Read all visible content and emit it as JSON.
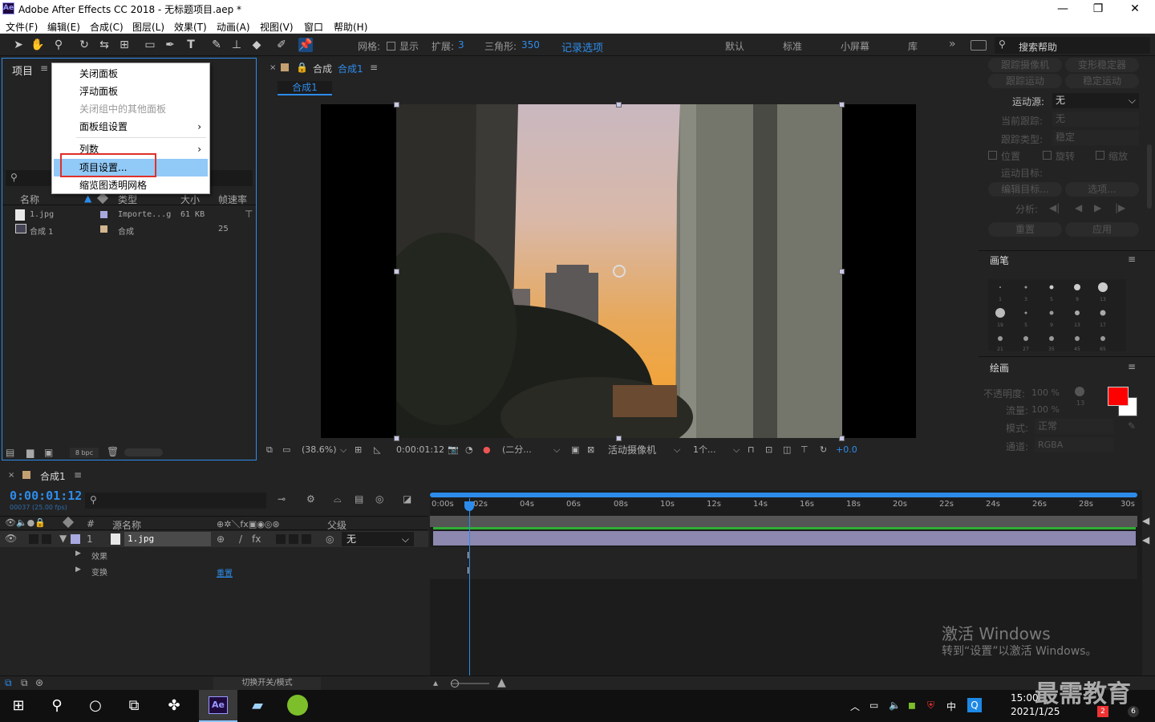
{
  "app": {
    "title": "Adobe After Effects CC 2018 - 无标题项目.aep *",
    "logo": "Ae"
  },
  "window_controls": {
    "minimize": "—",
    "maximize": "❐",
    "close": "✕"
  },
  "menu": [
    "文件(F)",
    "编辑(E)",
    "合成(C)",
    "图层(L)",
    "效果(T)",
    "动画(A)",
    "视图(V)",
    "窗口",
    "帮助(H)"
  ],
  "toolbar": {
    "grid_label": "网格:",
    "show_label": "显示",
    "expand_label": "扩展:",
    "expand_value": "3",
    "triangle_label": "三角形:",
    "triangle_value": "350",
    "record_options": "记录选项",
    "workspaces": [
      "默认",
      "标准",
      "小屏幕",
      "库"
    ],
    "more": "»",
    "search_help": "搜索帮助"
  },
  "project_panel": {
    "title": "项目",
    "menu_icon": "≡",
    "columns": [
      "名称",
      "类型",
      "大小",
      "帧速率"
    ],
    "items": [
      {
        "name": "1.jpg",
        "type": "Importe...g",
        "size": "61 KB",
        "fps": ""
      },
      {
        "name": "合成 1",
        "type": "合成",
        "size": "",
        "fps": "25"
      }
    ],
    "bpc": "8 bpc"
  },
  "context_menu": {
    "items": [
      {
        "label": "关闭面板",
        "disabled": false,
        "submenu": false
      },
      {
        "label": "浮动面板",
        "disabled": false,
        "submenu": false
      },
      {
        "label": "关闭组中的其他面板",
        "disabled": true,
        "submenu": false
      },
      {
        "label": "面板组设置",
        "disabled": false,
        "submenu": true
      },
      {
        "label": "列数",
        "disabled": false,
        "submenu": true
      },
      {
        "label": "项目设置...",
        "disabled": false,
        "submenu": false,
        "selected": true
      },
      {
        "label": "缩览图透明网格",
        "disabled": false,
        "submenu": false
      }
    ]
  },
  "composition_panel": {
    "tab_prefix": "合成",
    "tab_name": "合成1",
    "crumb": "合成1",
    "zoom": "(38.6%)",
    "timecode": "0:00:01:12",
    "resolution": "(二分...",
    "camera": "活动摄像机",
    "views": "1个...",
    "exposure": "+0.0"
  },
  "tracker_panel": {
    "btn_track_camera": "跟踪摄像机",
    "btn_warp_stabilizer": "变形稳定器",
    "btn_track_motion": "跟踪运动",
    "btn_stabilize_motion": "稳定运动",
    "motion_source_label": "运动源:",
    "motion_source_value": "无",
    "current_track_label": "当前跟踪:",
    "current_track_value": "无",
    "track_type_label": "跟踪类型:",
    "track_type_value": "稳定",
    "position": "位置",
    "rotation": "旋转",
    "scale": "缩放",
    "motion_target_label": "运动目标:",
    "edit_target": "编辑目标...",
    "options": "选项...",
    "analyze_label": "分析:",
    "reset": "重置",
    "apply": "应用"
  },
  "brushes_panel": {
    "title": "画笔",
    "sizes": [
      "1",
      "3",
      "5",
      "9",
      "13",
      "19",
      "5",
      "9",
      "13",
      "17",
      "21",
      "27",
      "35",
      "45",
      "65"
    ]
  },
  "paint_panel": {
    "title": "绘画",
    "opacity_label": "不透明度:",
    "opacity_value": "100 %",
    "flow_label": "流量:",
    "flow_value": "100 %",
    "mode_label": "模式:",
    "mode_value": "正常",
    "channel_label": "通道:",
    "channel_value": "RGBA",
    "small_value": "13",
    "fg_color": "#ff0000",
    "bg_color": "#ffffff"
  },
  "timeline": {
    "tab": "合成1",
    "timecode": "0:00:01:12",
    "frame_info": "00037 (25.00 fps)",
    "col_source": "源名称",
    "col_parent": "父级",
    "col_hash": "#",
    "layer": {
      "index": "1",
      "name": "1.jpg",
      "parent": "无"
    },
    "effects_label": "效果",
    "transform_label": "变换",
    "reset_label": "重置",
    "ruler": [
      "0:00s",
      "02s",
      "04s",
      "06s",
      "08s",
      "10s",
      "12s",
      "14s",
      "16s",
      "18s",
      "20s",
      "22s",
      "24s",
      "26s",
      "28s",
      "30s"
    ],
    "toggle_switches": "切换开关/模式",
    "playhead_fraction": 0.05
  },
  "watermark": {
    "line1": "激活 Windows",
    "line2": "转到“设置”以激活 Windows。",
    "brand": "最需教育"
  },
  "taskbar": {
    "time": "15:00",
    "date": "2021/1/25",
    "ime": "中",
    "badge1": "2",
    "badge2": "6"
  }
}
